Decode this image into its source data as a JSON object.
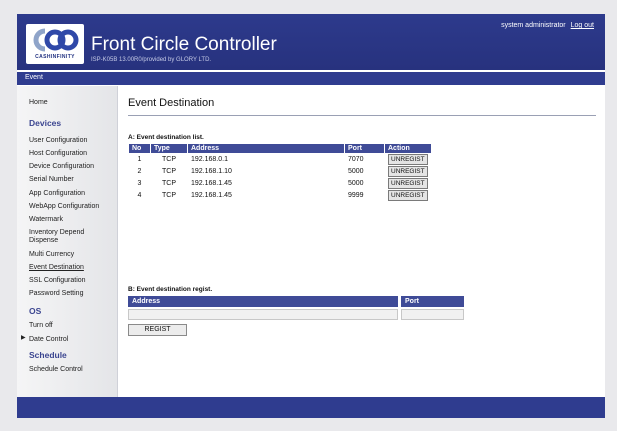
{
  "header": {
    "brand": "CASHINFINITY",
    "title": "Front Circle Controller",
    "subtitle": "ISP-K05B 13.00R0/provided by GLORY LTD.",
    "user": "system administrator",
    "logout": "Log out"
  },
  "breadcrumb": "Event",
  "sidebar": {
    "home": "Home",
    "devices_title": "Devices",
    "devices": [
      "User Configuration",
      "Host Configuration",
      "Device Configuration",
      "Serial Number",
      "App Configuration",
      "WebApp Configuration",
      "Watermark",
      "Inventory Depend",
      "Dispense",
      "Multi Currency",
      "Event Destination",
      "SSL Configuration",
      "Password Setting"
    ],
    "os_title": "OS",
    "os": [
      "Turn off",
      "Date Control"
    ],
    "schedule_title": "Schedule",
    "schedule": [
      "Schedule Control"
    ]
  },
  "main": {
    "title": "Event Destination",
    "list_label": "A: Event destination list.",
    "columns": [
      "No",
      "Type",
      "Address",
      "Port",
      "Action"
    ],
    "rows": [
      {
        "no": "1",
        "type": "TCP",
        "address": "192.168.0.1",
        "port": "7070",
        "action": "UNREGIST"
      },
      {
        "no": "2",
        "type": "TCP",
        "address": "192.168.1.10",
        "port": "5000",
        "action": "UNREGIST"
      },
      {
        "no": "3",
        "type": "TCP",
        "address": "192.168.1.45",
        "port": "5000",
        "action": "UNREGIST"
      },
      {
        "no": "4",
        "type": "TCP",
        "address": "192.168.1.45",
        "port": "9999",
        "action": "UNREGIST"
      }
    ],
    "regist_label": "B: Event destination regist.",
    "regist_address": "Address",
    "regist_port": "Port",
    "address_value": "",
    "port_value": "",
    "regist_button": "REGIST"
  },
  "colors": {
    "header": "#2d3a8c",
    "table_header": "#3f4b97",
    "section": "#3b4590"
  }
}
